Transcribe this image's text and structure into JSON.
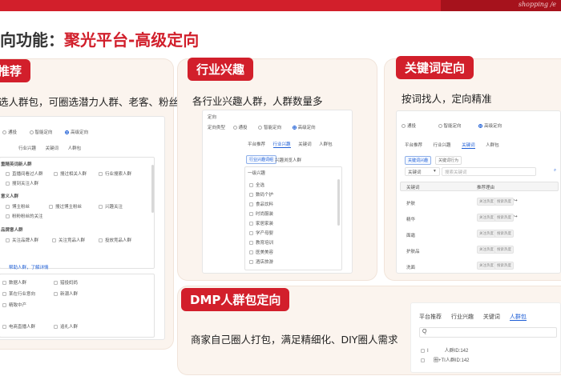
{
  "header": {
    "brand_text": "shopping /e"
  },
  "title": {
    "part1": "向功能：",
    "part2": "聚光平台-高级定向"
  },
  "cards": {
    "crowd": {
      "badge": "推荐",
      "desc": "选人群包，可圈选潜力人群、老客、粉丝",
      "ui": {
        "radios": [
          "通投",
          "智能定向",
          "高级定向"
        ],
        "tabs": [
          "行业兴趣",
          "关键词",
          "人群包"
        ],
        "section1": "重精英词新人群",
        "section1_items": [
          "直播间看过人群",
          "搜过相关人群",
          "行业搜索人群",
          "搜到关注人群"
        ],
        "section2": "意义人群",
        "section2_items": [
          "博主粉丝",
          "搜过博主粉丝",
          "兴趣关注",
          "粉粉粉丝的关注"
        ],
        "section3": "品牌意人群",
        "section3_items": [
          "关注品牌人群",
          "关注竞品人群",
          "投放竞品人群"
        ],
        "hint": "帮助人群，了解详情",
        "list_items": [
          "数据人群",
          "猎投妈妈",
          "某在行业意向",
          "新潮人群",
          "精致中产",
          "电商直播人群",
          "追礼人群"
        ]
      }
    },
    "industry": {
      "badge": "行业兴趣",
      "desc": "各行业兴趣人群，人群数量多",
      "ui": {
        "section_label": "定向",
        "row_label": "定向类型",
        "radios": [
          "通投",
          "智能定向",
          "高级定向"
        ],
        "tabs": [
          "平台推荐",
          "行业兴趣",
          "关键词",
          "人群包"
        ],
        "sub_tabs": [
          "行业兴趣词组",
          "兴趣浏览人群"
        ],
        "list_header": "一级兴趣",
        "list_items": [
          "全选",
          "数码个护",
          "食品饮料",
          "时尚服装",
          "家居家装",
          "学产母婴",
          "教育培训",
          "医美美容",
          "酒店旅游"
        ]
      }
    },
    "keyword": {
      "badge": "关键词定向",
      "desc": "按词找人，定向精准",
      "ui": {
        "radios": [
          "通投",
          "智能定向",
          "高级定向"
        ],
        "tabs": [
          "平台推荐",
          "行业兴趣",
          "关键词",
          "人群包"
        ],
        "sub_buttons": [
          "关键词兴趣",
          "关键词行为"
        ],
        "select_label": "关键词",
        "search_placeholder": "搜索关键词",
        "col_keyword": "关键词",
        "col_recommend": "推荐理由",
        "rows": [
          "护肤",
          "精华",
          "面霜",
          "护肤品",
          "洗面"
        ],
        "tag_a": "关注热度",
        "tag_b": "搜索热度"
      }
    },
    "dmp": {
      "badge": "DMP人群包定向",
      "desc": "商家自己圈人打包，满足精细化、DIY圈人需求",
      "ui": {
        "tabs": [
          "平台推荐",
          "行业兴趣",
          "关键词",
          "人群包"
        ],
        "search_icon_text": "Q",
        "rows": [
          {
            "mark": "I",
            "name": "人群ID:142"
          },
          {
            "mark": "",
            "name": "圈+TI人群ID:142"
          }
        ]
      }
    }
  }
}
